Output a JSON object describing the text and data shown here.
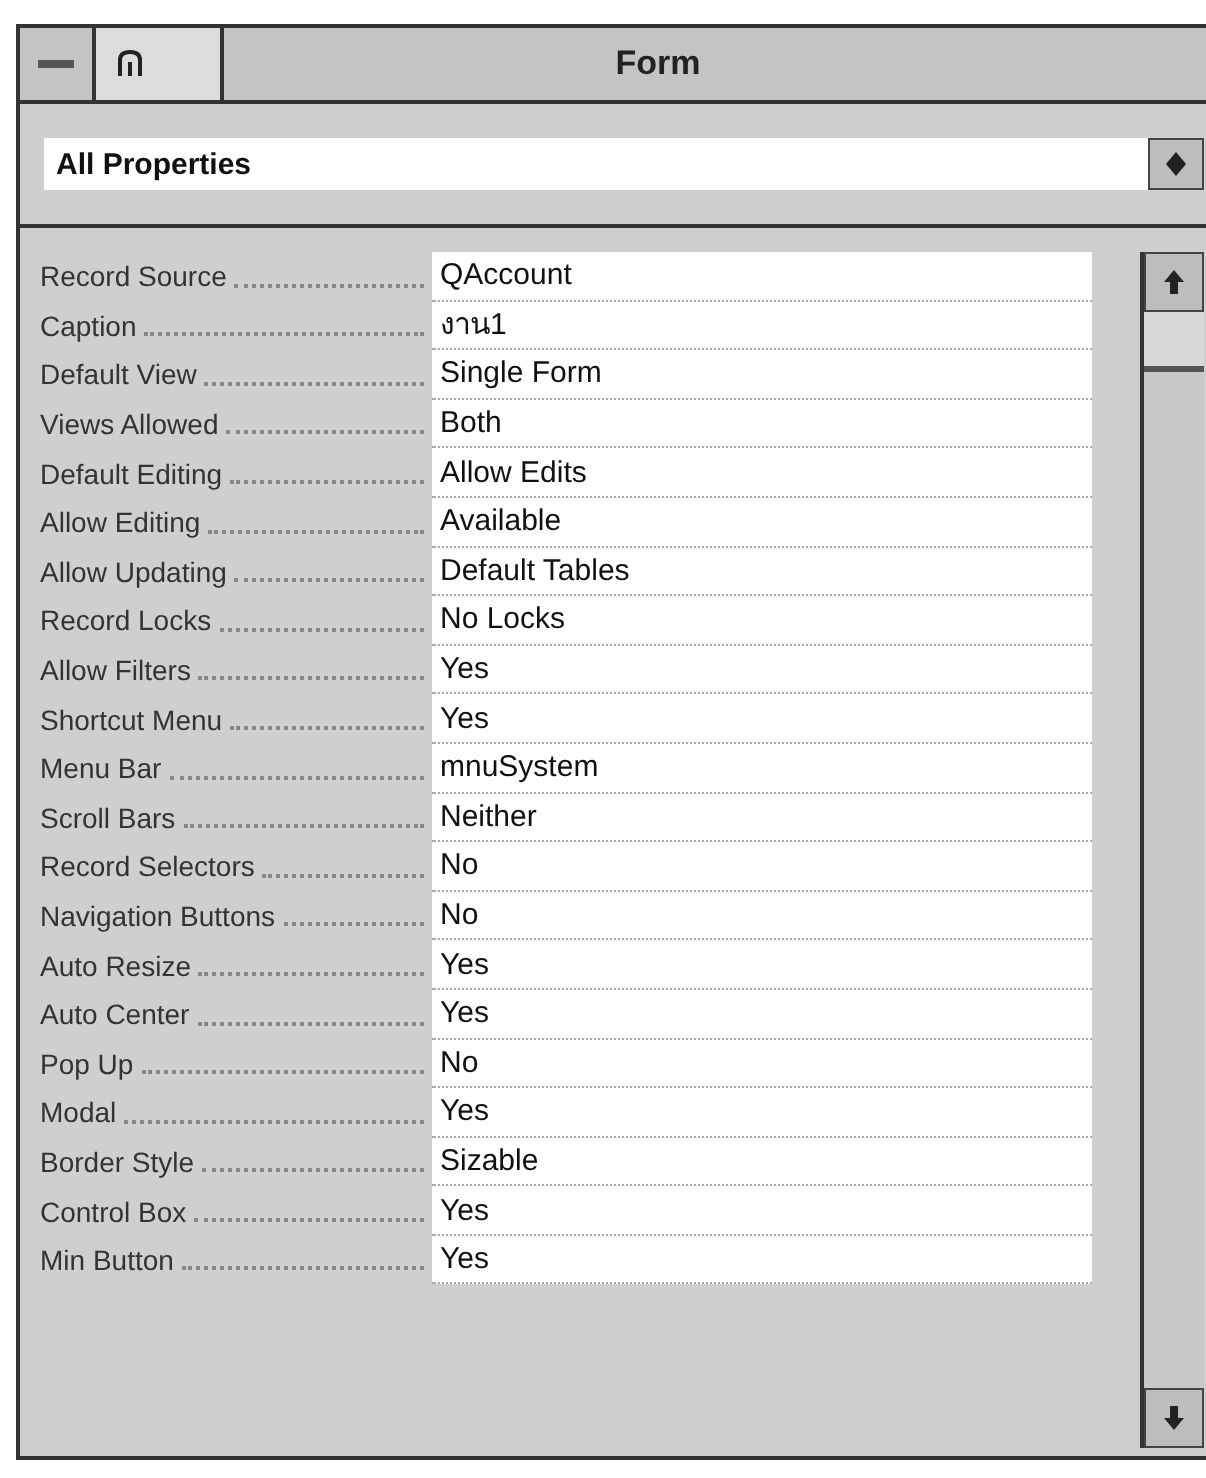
{
  "window": {
    "title": "Form"
  },
  "filter": {
    "value": "All Properties"
  },
  "properties": [
    {
      "name": "Record Source",
      "value": "QAccount"
    },
    {
      "name": "Caption",
      "value": "งาน1"
    },
    {
      "name": "Default View",
      "value": "Single Form"
    },
    {
      "name": "Views Allowed",
      "value": "Both"
    },
    {
      "name": "Default Editing",
      "value": "Allow Edits"
    },
    {
      "name": "Allow Editing",
      "value": "Available"
    },
    {
      "name": "Allow Updating",
      "value": "Default Tables"
    },
    {
      "name": "Record Locks",
      "value": "No Locks"
    },
    {
      "name": "Allow Filters",
      "value": "Yes"
    },
    {
      "name": "Shortcut Menu",
      "value": "Yes"
    },
    {
      "name": "Menu Bar",
      "value": "mnuSystem"
    },
    {
      "name": "Scroll Bars",
      "value": "Neither"
    },
    {
      "name": "Record Selectors",
      "value": "No"
    },
    {
      "name": "Navigation Buttons",
      "value": "No"
    },
    {
      "name": "Auto Resize",
      "value": "Yes"
    },
    {
      "name": "Auto Center",
      "value": "Yes"
    },
    {
      "name": "Pop Up",
      "value": "No"
    },
    {
      "name": "Modal",
      "value": "Yes"
    },
    {
      "name": "Border Style",
      "value": "Sizable"
    },
    {
      "name": "Control Box",
      "value": "Yes"
    },
    {
      "name": "Min Button",
      "value": "Yes"
    }
  ]
}
